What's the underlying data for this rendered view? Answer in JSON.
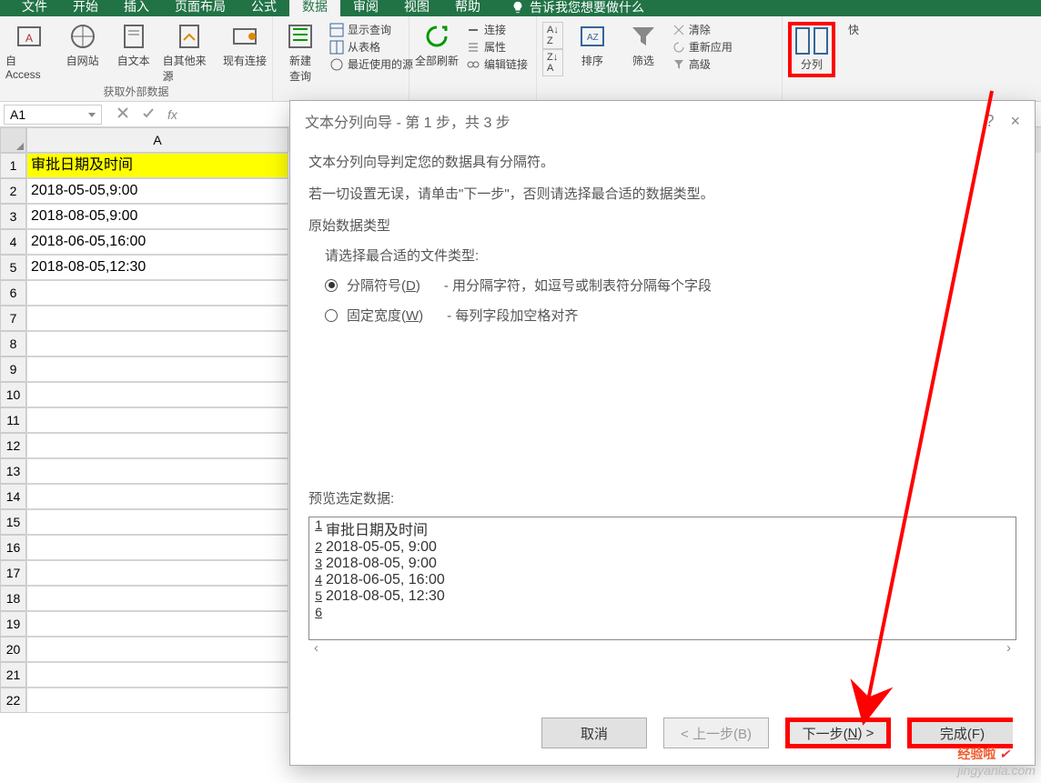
{
  "tabs": {
    "file": "文件",
    "start": "开始",
    "insert": "插入",
    "layout": "页面布局",
    "formula": "公式",
    "data": "数据",
    "review": "审阅",
    "view": "视图",
    "help": "帮助",
    "search": "告诉我您想要做什么"
  },
  "ribbon": {
    "ext": {
      "access": "自 Access",
      "web": "自网站",
      "text": "自文本",
      "other": "自其他来源",
      "existing": "现有连接",
      "label": "获取外部数据"
    },
    "newquery": {
      "title": "新建\n查询",
      "showquery": "显示查询",
      "fromtable": "从表格",
      "recent": "最近使用的源"
    },
    "refresh": {
      "title": "全部刷新",
      "connect": "连接",
      "props": "属性",
      "editlinks": "编辑链接"
    },
    "sort": {
      "az": "A↓Z",
      "za": "Z↓A",
      "sort": "排序",
      "filter": "筛选",
      "clear": "清除",
      "reapply": "重新应用",
      "advanced": "高级"
    },
    "fenlie": "分列",
    "quick": "快"
  },
  "namebox": "A1",
  "grid": {
    "colA": "A",
    "rows": [
      {
        "n": "1",
        "v": "审批日期及时间",
        "hilite": true
      },
      {
        "n": "2",
        "v": "2018-05-05,9:00"
      },
      {
        "n": "3",
        "v": "2018-08-05,9:00"
      },
      {
        "n": "4",
        "v": "2018-06-05,16:00"
      },
      {
        "n": "5",
        "v": "2018-08-05,12:30"
      },
      {
        "n": "6",
        "v": ""
      },
      {
        "n": "7",
        "v": ""
      },
      {
        "n": "8",
        "v": ""
      },
      {
        "n": "9",
        "v": ""
      },
      {
        "n": "10",
        "v": ""
      },
      {
        "n": "11",
        "v": ""
      },
      {
        "n": "12",
        "v": ""
      },
      {
        "n": "13",
        "v": ""
      },
      {
        "n": "14",
        "v": ""
      },
      {
        "n": "15",
        "v": ""
      },
      {
        "n": "16",
        "v": ""
      },
      {
        "n": "17",
        "v": ""
      },
      {
        "n": "18",
        "v": ""
      },
      {
        "n": "19",
        "v": ""
      },
      {
        "n": "20",
        "v": ""
      },
      {
        "n": "21",
        "v": ""
      },
      {
        "n": "22",
        "v": ""
      }
    ]
  },
  "dialog": {
    "title": "文本分列向导 - 第 1 步，共 3 步",
    "help": "?",
    "close": "×",
    "p1": "文本分列向导判定您的数据具有分隔符。",
    "p2": "若一切设置无误，请单击\"下一步\"，否则请选择最合适的数据类型。",
    "fs_title": "原始数据类型",
    "fs_hint": "请选择最合适的文件类型:",
    "opt1": "分隔符号(D)",
    "opt1_desc": "- 用分隔字符，如逗号或制表符分隔每个字段",
    "opt2": "固定宽度(W)",
    "opt2_desc": "- 每列字段加空格对齐",
    "preview_label": "预览选定数据:",
    "preview": [
      {
        "n": "1",
        "t": "审批日期及时间"
      },
      {
        "n": "2",
        "t": "2018-05-05, 9:00"
      },
      {
        "n": "3",
        "t": "2018-08-05, 9:00"
      },
      {
        "n": "4",
        "t": "2018-06-05, 16:00"
      },
      {
        "n": "5",
        "t": "2018-08-05, 12:30"
      },
      {
        "n": "6",
        "t": ""
      }
    ],
    "btn_cancel": "取消",
    "btn_back": "< 上一步(B)",
    "btn_next": "下一步(N) >",
    "btn_finish": "完成(F)"
  },
  "watermark": {
    "domain": "jingyanla.com",
    "brand": "经验啦"
  }
}
